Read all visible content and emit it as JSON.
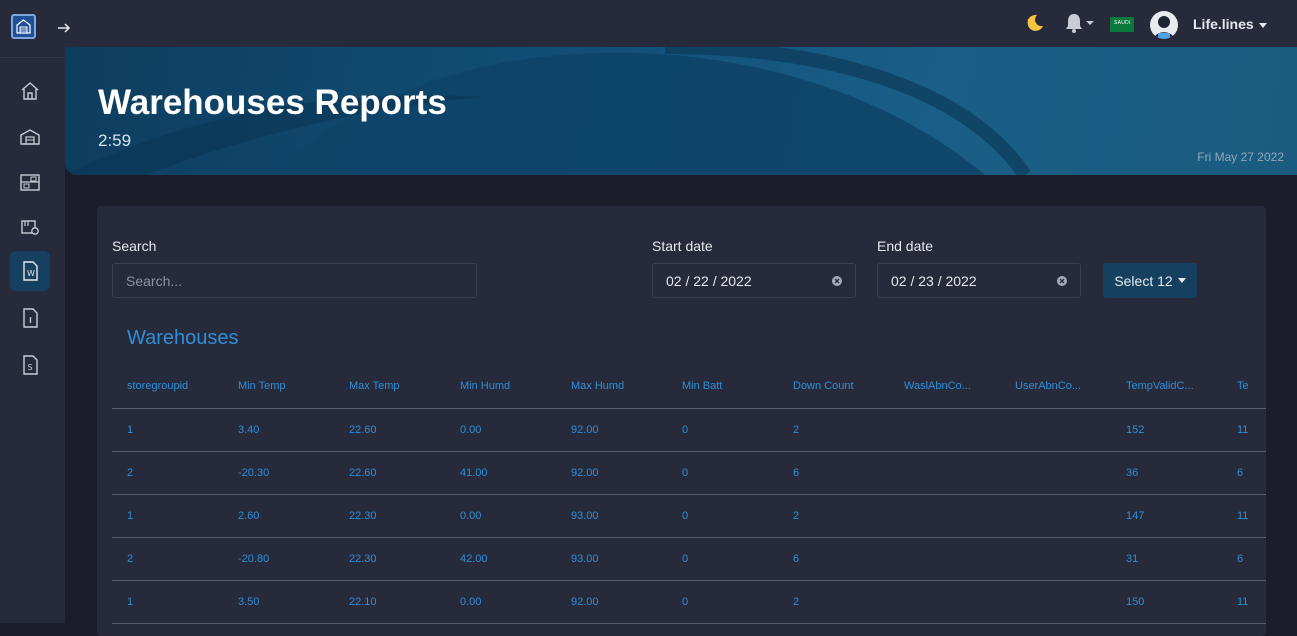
{
  "topbar": {
    "username": "Life.lines",
    "flag_text": "SAUDI",
    "icons": [
      "expand-sidebar-icon",
      "moon-icon",
      "bell-icon",
      "flag-icon",
      "avatar"
    ]
  },
  "sidebar": {
    "items": [
      {
        "name": "home",
        "icon": "home-icon"
      },
      {
        "name": "warehouse",
        "icon": "warehouse-icon"
      },
      {
        "name": "storage",
        "icon": "shelves-icon"
      },
      {
        "name": "devices",
        "icon": "device-settings-icon"
      },
      {
        "name": "warehouse-report",
        "icon": "doc-w-icon",
        "active": true
      },
      {
        "name": "info-report",
        "icon": "doc-i-icon"
      },
      {
        "name": "summary-report",
        "icon": "doc-s-icon"
      }
    ]
  },
  "banner": {
    "title": "Warehouses Reports",
    "clock": "2:59",
    "date": "Fri May 27 2022"
  },
  "filters": {
    "search_label": "Search",
    "search_placeholder": "Search...",
    "start_label": "Start date",
    "start_value": "02 / 22 / 2022",
    "end_label": "End date",
    "end_value": "02 / 23 / 2022",
    "select_label": "Select 12"
  },
  "table": {
    "title": "Warehouses",
    "columns": [
      "storegroupid",
      "Min Temp",
      "Max Temp",
      "Min Humd",
      "Max Humd",
      "Min Batt",
      "Down Count",
      "WaslAbnCo...",
      "UserAbnCo...",
      "TempValidC...",
      "Te"
    ],
    "rows": [
      [
        "1",
        "3.40",
        "22.60",
        "0.00",
        "92.00",
        "0",
        "2",
        "",
        "",
        "152",
        "11"
      ],
      [
        "2",
        "-20.30",
        "22.60",
        "41.00",
        "92.00",
        "0",
        "6",
        "",
        "",
        "36",
        "6"
      ],
      [
        "1",
        "2.60",
        "22.30",
        "0.00",
        "93.00",
        "0",
        "2",
        "",
        "",
        "147",
        "11"
      ],
      [
        "2",
        "-20.80",
        "22.30",
        "42.00",
        "93.00",
        "0",
        "6",
        "",
        "",
        "31",
        "6"
      ],
      [
        "1",
        "3.50",
        "22.10",
        "0.00",
        "92.00",
        "0",
        "2",
        "",
        "",
        "150",
        "11"
      ]
    ]
  },
  "colors": {
    "background": "#1b1d2a",
    "panel": "#262a3a",
    "accent": "#2e8fd9",
    "active": "#15405f"
  }
}
